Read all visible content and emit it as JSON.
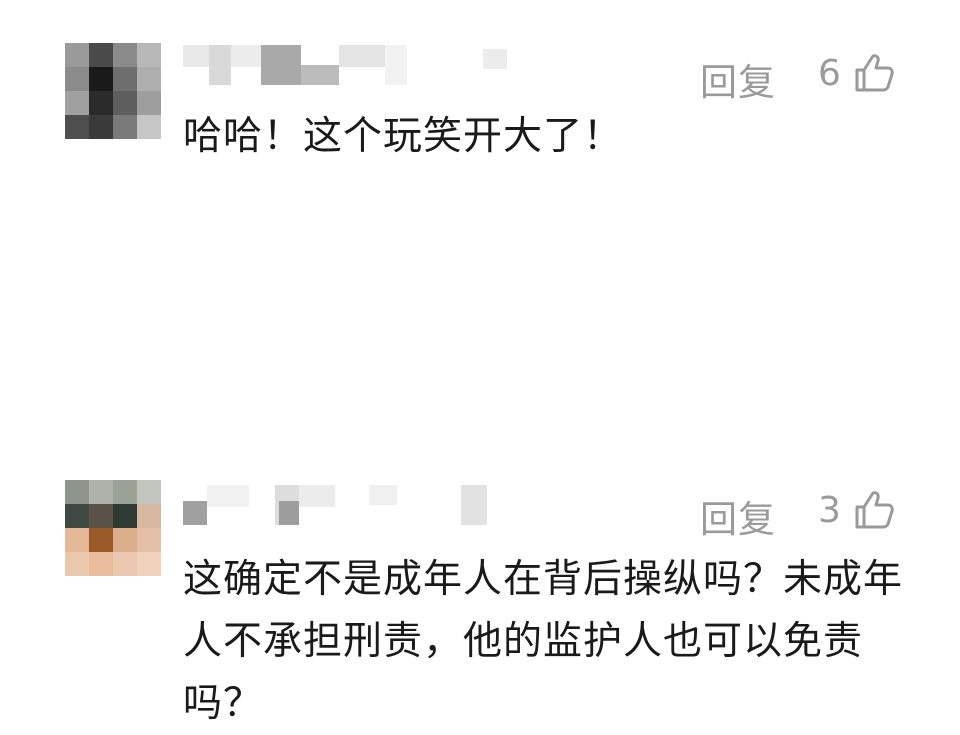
{
  "comments": [
    {
      "reply_label": "回复",
      "like_count": "6",
      "text": "哈哈！这个玩笑开大了！",
      "avatar_colors": [
        "#9a9a9a",
        "#4a4a4a",
        "#8a8a8a",
        "#b8b8b8",
        "#8c8c8c",
        "#1a1a1a",
        "#6e6e6e",
        "#aeaeae",
        "#a0a0a0",
        "#2a2a2a",
        "#5e5e5e",
        "#9e9e9e",
        "#4e4e4e",
        "#3a3a3a",
        "#7a7a7a",
        "#c6c6c6"
      ]
    },
    {
      "reply_label": "回复",
      "like_count": "3",
      "text": "这确定不是成年人在背后操纵吗？未成年人不承担刑责，他的监护人也可以免责吗？",
      "avatar_colors": [
        "#8e958c",
        "#aeb2ab",
        "#9aa296",
        "#c2c6be",
        "#3e4a42",
        "#5a5248",
        "#2f3a34",
        "#d8b8a0",
        "#e4b898",
        "#9a5a2a",
        "#dcae8c",
        "#e6c0a6",
        "#eac8ae",
        "#e8bc9c",
        "#ecc8b0",
        "#f0d2bc"
      ]
    }
  ],
  "colors": {
    "meta_gray": "#9a9a9a",
    "text": "#1a1a1a"
  },
  "icons": [
    "thumbs-up-icon"
  ]
}
